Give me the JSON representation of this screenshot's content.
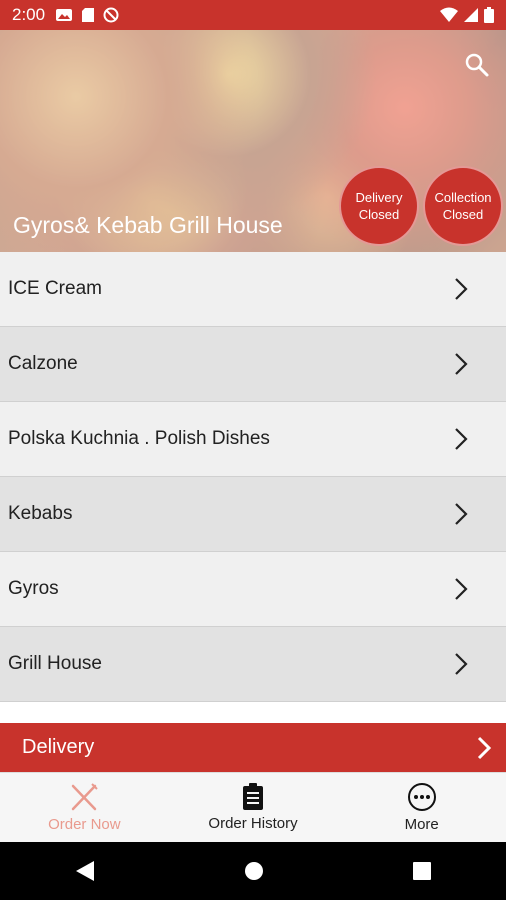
{
  "status_bar": {
    "time": "2:00"
  },
  "hero": {
    "restaurant_name": "Gyros& Kebab Grill House",
    "delivery_badge": {
      "line1": "Delivery",
      "line2": "Closed"
    },
    "collection_badge": {
      "line1": "Collection",
      "line2": "Closed"
    }
  },
  "menu": {
    "categories": [
      {
        "label": "ICE Cream"
      },
      {
        "label": "Calzone"
      },
      {
        "label": "Polska Kuchnia . Polish Dishes"
      },
      {
        "label": "Kebabs"
      },
      {
        "label": "Gyros"
      },
      {
        "label": "Grill House"
      }
    ]
  },
  "delivery_bar": {
    "label": "Delivery"
  },
  "tabs": [
    {
      "label": "Order Now",
      "icon": "fork-knife-icon",
      "active": true
    },
    {
      "label": "Order History",
      "icon": "clipboard-icon",
      "active": false
    },
    {
      "label": "More",
      "icon": "more-dots-icon",
      "active": false
    }
  ],
  "colors": {
    "accent": "#c8332c",
    "active_tab": "#e99a8e"
  }
}
